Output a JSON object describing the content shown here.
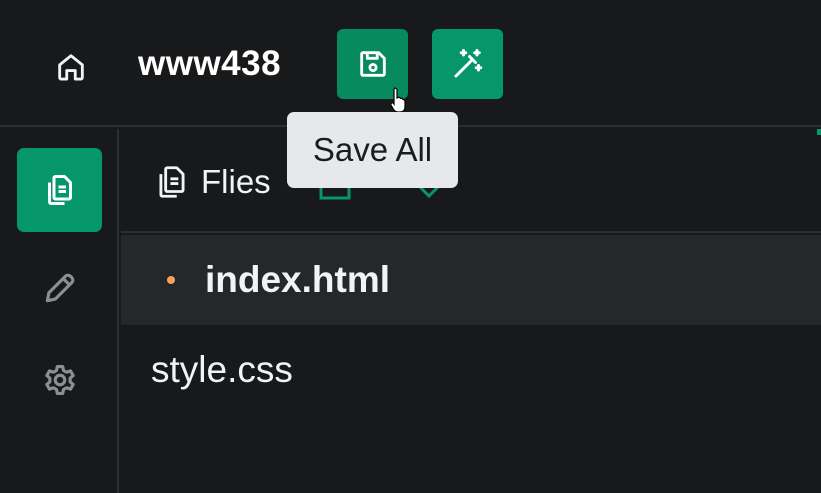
{
  "header": {
    "project_name": "www438",
    "home_icon": "home-icon",
    "save_button_icon": "save-icon",
    "magic_button_icon": "magic-wand-icon",
    "tooltip": "Save All"
  },
  "sidebar": {
    "items": [
      {
        "name": "files",
        "icon": "files-icon",
        "active": true
      },
      {
        "name": "edit",
        "icon": "pencil-icon",
        "active": false
      },
      {
        "name": "settings",
        "icon": "gear-icon",
        "active": false
      }
    ]
  },
  "files_panel": {
    "title": "Flies",
    "files": [
      {
        "name": "index.html",
        "modified": true,
        "active": true
      },
      {
        "name": "style.css",
        "modified": false,
        "active": false
      }
    ]
  },
  "colors": {
    "accent": "#059669",
    "background": "#18191b",
    "active_row": "#25282b",
    "modified_dot": "#f4a15d",
    "tooltip_bg": "#e6e8eb"
  }
}
